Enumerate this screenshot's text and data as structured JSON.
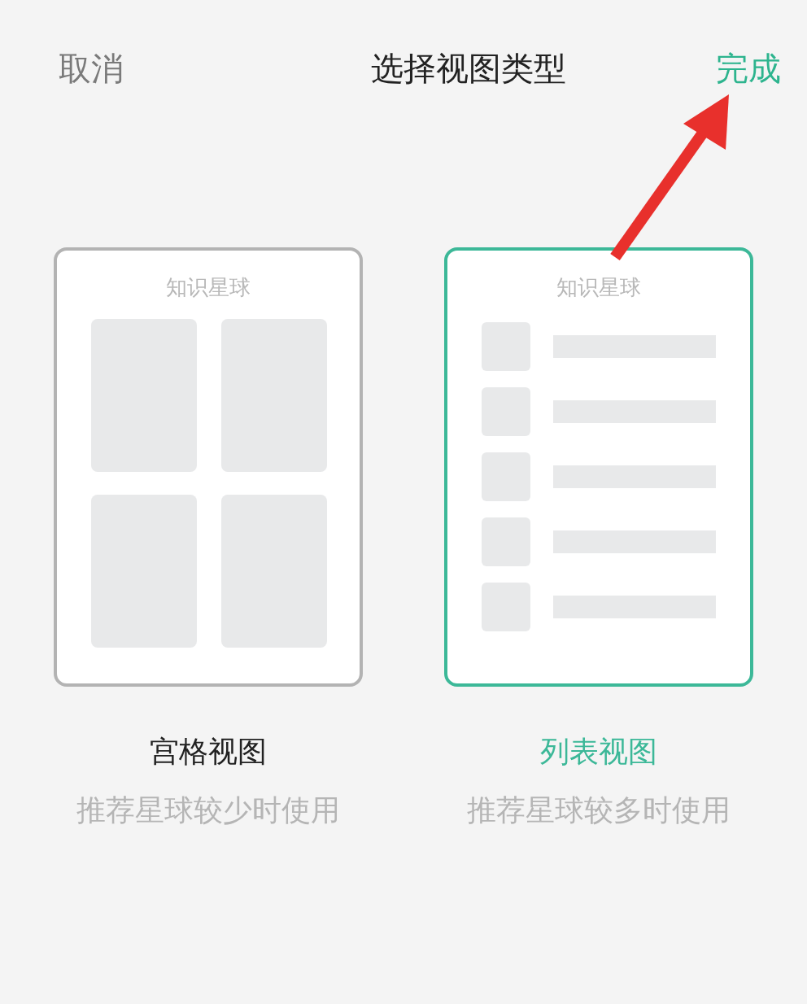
{
  "header": {
    "cancel": "取消",
    "title": "选择视图类型",
    "done": "完成"
  },
  "options": [
    {
      "kind": "grid",
      "card_title": "知识星球",
      "name": "宫格视图",
      "hint": "推荐星球较少时使用",
      "selected": false
    },
    {
      "kind": "list",
      "card_title": "知识星球",
      "name": "列表视图",
      "hint": "推荐星球较多时使用",
      "selected": true
    }
  ]
}
